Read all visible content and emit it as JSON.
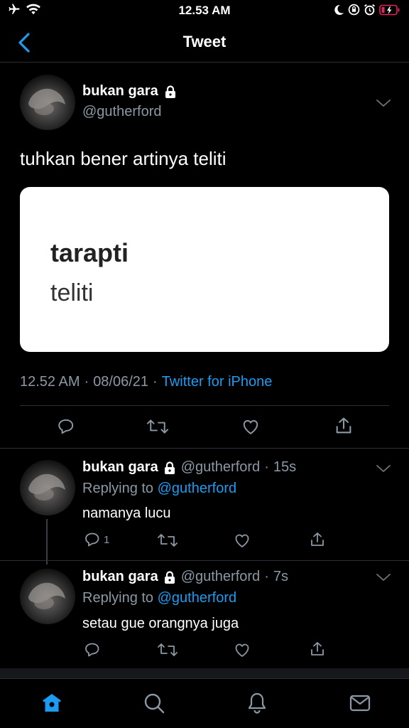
{
  "status_bar": {
    "time": "12.53 AM"
  },
  "nav": {
    "title": "Tweet"
  },
  "main_tweet": {
    "name": "bukan gara",
    "handle": "@gutherford",
    "text": "tuhkan bener artinya teliti",
    "card": {
      "word": "tarapti",
      "definition": "teliti"
    },
    "time": "12.52 AM",
    "date": "08/06/21",
    "separator": "·",
    "source": "Twitter for iPhone"
  },
  "replies": [
    {
      "name": "bukan gara",
      "handle": "@gutherford",
      "dot": "·",
      "time": "15s",
      "replying_label": "Replying to",
      "replying_to": "@gutherford",
      "text": "namanya lucu",
      "reply_count": "1"
    },
    {
      "name": "bukan gara",
      "handle": "@gutherford",
      "dot": "·",
      "time": "7s",
      "replying_label": "Replying to",
      "replying_to": "@gutherford",
      "text": "setau gue orangnya juga",
      "reply_count": ""
    }
  ],
  "tabs": [
    "home-icon",
    "search-icon",
    "notifications-icon",
    "messages-icon"
  ],
  "colors": {
    "accent": "#1d9bf0",
    "muted": "#8b98a5",
    "background": "#000000",
    "battery": "#e0245e"
  }
}
